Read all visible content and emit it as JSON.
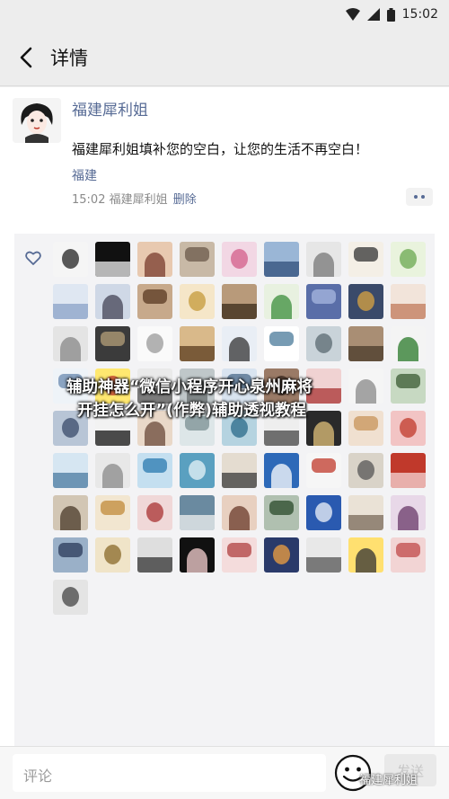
{
  "status_bar": {
    "time": "15:02",
    "icons": [
      "wifi-icon",
      "signal-icon",
      "battery-icon"
    ]
  },
  "nav": {
    "title": "详情",
    "back_icon": "back-arrow-icon"
  },
  "post": {
    "author": "福建犀利姐",
    "text": "福建犀利姐填补您的空白，让您的生活不再空白！",
    "location": "福建",
    "time": "15:02",
    "author_meta": "福建犀利姐",
    "delete_label": "删除"
  },
  "likes": {
    "icon": "heart-outline-icon",
    "avatar_count": 73
  },
  "overlay": {
    "line1": "辅助神器“微信小程序开心泉州麻将",
    "line2": "开挂怎么开”(作弊)辅助透视教程"
  },
  "comment": {
    "placeholder": "评论",
    "send_label": "发送",
    "emoji_icon": "emoji-face-icon"
  },
  "watermark": "福建犀利姐",
  "colors": {
    "link": "#576b95",
    "background": "#ededed",
    "panel": "#f3f3f5"
  }
}
